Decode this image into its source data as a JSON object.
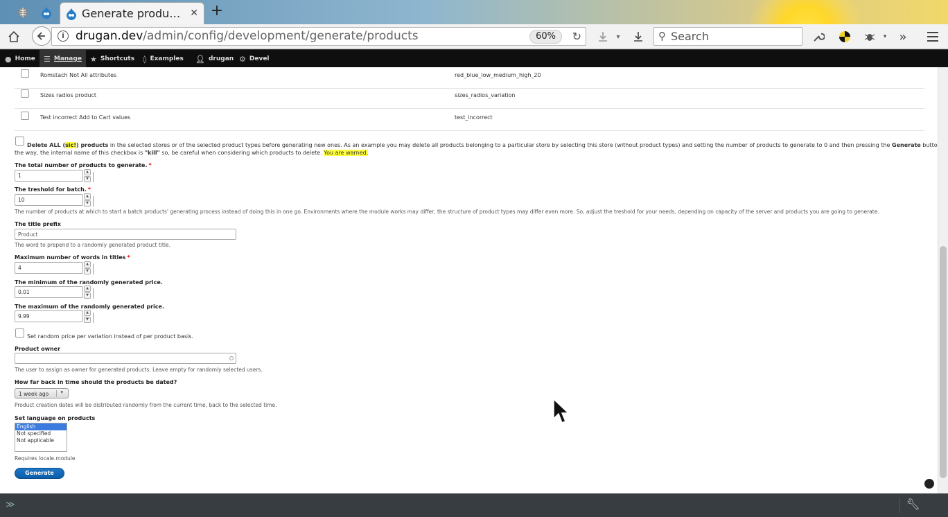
{
  "browser": {
    "tab_title": "Generate product…",
    "url_host": "drugan.dev",
    "url_path": "/admin/config/development/generate/products",
    "zoom": "60%",
    "search_placeholder": "Search"
  },
  "toolbar": {
    "items": [
      {
        "label": "Home",
        "icon": "home-icon"
      },
      {
        "label": "Manage",
        "icon": "menu-icon"
      },
      {
        "label": "Shortcuts",
        "icon": "star-icon"
      },
      {
        "label": "Examples",
        "icon": "drop-icon"
      },
      {
        "label": "drugan",
        "icon": "user-icon"
      },
      {
        "label": "Devel",
        "icon": "gear-icon"
      }
    ]
  },
  "products": [
    {
      "name": "Romstach Not All attributes",
      "variation": "red_blue_low_medium_high_20"
    },
    {
      "name": "Sizes radios product",
      "variation": "sizes_radios_variation"
    },
    {
      "name": "Test incorrect Add to Cart values",
      "variation": "test_incorrect"
    }
  ],
  "delete_all": {
    "prefix": "Delete ALL (",
    "sic": "sic!",
    "suffix": ") products",
    "text1": " in the selected stores or of the selected product types before generating new ones. As an example you may delete all products belonging to a particular store by selecting this store (without product types) and setting the number of products to generate to 0 and then pressing the ",
    "generate_word": "Generate",
    "text2": " button. By",
    "line2a": "the way, the internal name of this checkbox is ",
    "kill": "\"kill\"",
    "line2b": " so, be careful when considering which products to delete. ",
    "warned": "You are warned."
  },
  "form": {
    "total_label": "The total number of products to generate.",
    "total_value": "1",
    "threshold_label": "The treshold for batch.",
    "threshold_value": "10",
    "threshold_desc": "The number of products at which to start a batch products' generating process instead of doing this in one go. Environments where the module works may differ, the structure of product types may differ even more. So, adjust the treshold for your needs, depending on capacity of the server and products you are going to generate.",
    "prefix_label": "The title prefix",
    "prefix_value": "Product",
    "prefix_desc": "The word to prepend to a randomly generated product title.",
    "max_words_label": "Maximum number of words in titles",
    "max_words_value": "4",
    "min_price_label": "The minimum of the randomly generated price.",
    "min_price_value": "0.01",
    "max_price_label": "The maximum of the randomly generated price.",
    "max_price_value": "9.99",
    "random_price_label": "Set random price per variation instead of per product basis.",
    "owner_label": "Product owner",
    "owner_desc": "The user to assign as owner for generated products. Leave empty for randomly selected users.",
    "dated_label": "How far back in time should the products be dated?",
    "dated_value": "1 week ago",
    "dated_desc": "Product creation dates will be distributed randomly from the current time, back to the selected time.",
    "language_label": "Set language on products",
    "language_options": [
      "English",
      "Not specified",
      "Not applicable"
    ],
    "language_desc": "Requires locale.module",
    "required_mark": "*",
    "generate_button": "Generate"
  }
}
